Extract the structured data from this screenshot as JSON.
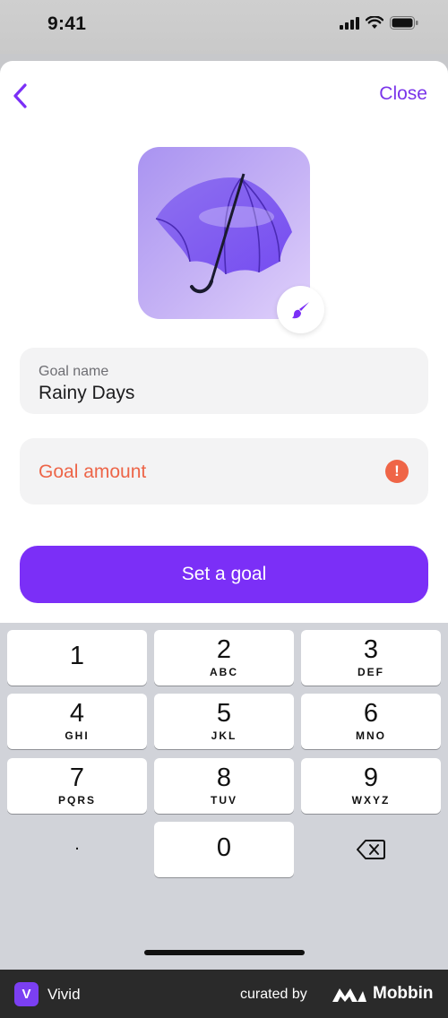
{
  "status_bar": {
    "time": "9:41"
  },
  "header": {
    "close_label": "Close"
  },
  "goal_name_field": {
    "label": "Goal name",
    "value": "Rainy Days"
  },
  "goal_amount_field": {
    "placeholder": "Goal amount",
    "error_symbol": "!"
  },
  "primary_button": {
    "label": "Set a goal"
  },
  "keypad": {
    "keys": [
      {
        "digit": "1",
        "letters": ""
      },
      {
        "digit": "2",
        "letters": "ABC"
      },
      {
        "digit": "3",
        "letters": "DEF"
      },
      {
        "digit": "4",
        "letters": "GHI"
      },
      {
        "digit": "5",
        "letters": "JKL"
      },
      {
        "digit": "6",
        "letters": "MNO"
      },
      {
        "digit": "7",
        "letters": "PQRS"
      },
      {
        "digit": "8",
        "letters": "TUV"
      },
      {
        "digit": "9",
        "letters": "WXYZ"
      },
      {
        "digit": "0",
        "letters": ""
      }
    ],
    "decimal": "."
  },
  "footer": {
    "app_initial": "V",
    "app_name": "Vivid",
    "curated_by": "curated by",
    "brand": "Mobbin"
  },
  "colors": {
    "accent": "#7b2ff7",
    "error": "#ef6547"
  }
}
